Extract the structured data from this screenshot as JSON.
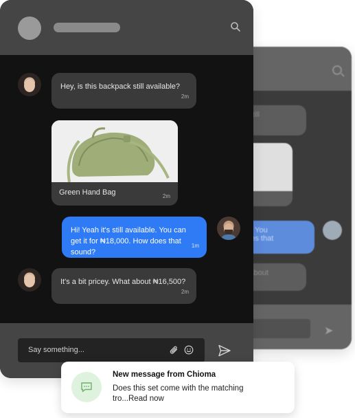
{
  "messages": [
    {
      "text": "Hey, is this backpack still available?",
      "time": "2m"
    },
    {
      "caption": "Green Hand Bag",
      "time": "2m"
    },
    {
      "text": "Hi! Yeah it's still available. You can get it for ₦18,000. How does that sound?",
      "time": "1m"
    },
    {
      "text": "It's a bit pricey. What about ₦16,500?",
      "time": "2m"
    }
  ],
  "composer": {
    "placeholder": "Say something..."
  },
  "toast": {
    "title": "New message from Chioma",
    "body": "Does this set come with the matching tro...Read now"
  },
  "back_window": {
    "snippets": [
      "ack still",
      "lable. You",
      "w does that",
      "that about"
    ]
  },
  "colors": {
    "background": "#121212",
    "header": "#454545",
    "incoming_bubble": "#3a3a3a",
    "outgoing_bubble": "#2f7af5",
    "toast_icon_bg": "#dff2dd",
    "toast_icon": "#6db06a"
  },
  "icons": [
    "search-icon",
    "paperclip-icon",
    "smiley-icon",
    "send-icon",
    "chat-bubble-icon"
  ]
}
